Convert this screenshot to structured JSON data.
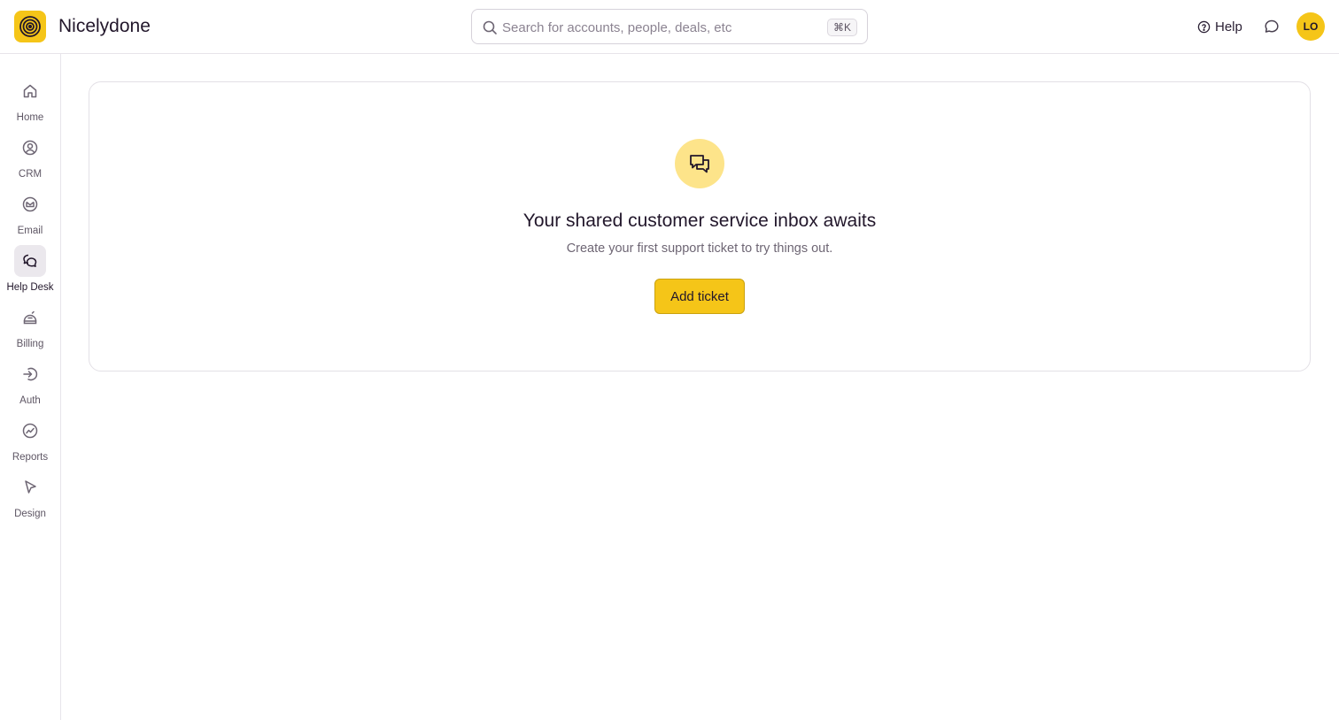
{
  "app": {
    "brand": "Nicelydone",
    "logo_icon": "spiral-logo-icon"
  },
  "colors": {
    "accent": "#f5c518",
    "accent_light": "#fde48a",
    "text": "#22172b",
    "muted": "#6e6674",
    "border": "#e3e0e6"
  },
  "header": {
    "search": {
      "placeholder": "Search for accounts, people, deals, etc",
      "shortcut": "⌘K",
      "icon": "search-icon"
    },
    "help_label": "Help",
    "help_icon": "question-circle-icon",
    "chat_icon": "chat-bubble-icon",
    "avatar_initials": "LO"
  },
  "sidebar": {
    "items": [
      {
        "label": "Home",
        "icon": "home-icon",
        "active": false
      },
      {
        "label": "CRM",
        "icon": "user-circle-icon",
        "active": false
      },
      {
        "label": "Email",
        "icon": "mail-icon",
        "active": false
      },
      {
        "label": "Help Desk",
        "icon": "chat-bubbles-icon",
        "active": true
      },
      {
        "label": "Billing",
        "icon": "billing-icon",
        "active": false
      },
      {
        "label": "Auth",
        "icon": "login-icon",
        "active": false
      },
      {
        "label": "Reports",
        "icon": "trend-icon",
        "active": false
      },
      {
        "label": "Design",
        "icon": "cursor-icon",
        "active": false
      }
    ]
  },
  "empty_state": {
    "icon": "conversation-icon",
    "title": "Your shared customer service inbox awaits",
    "subtitle": "Create your first support ticket to try things out.",
    "button_label": "Add ticket"
  }
}
